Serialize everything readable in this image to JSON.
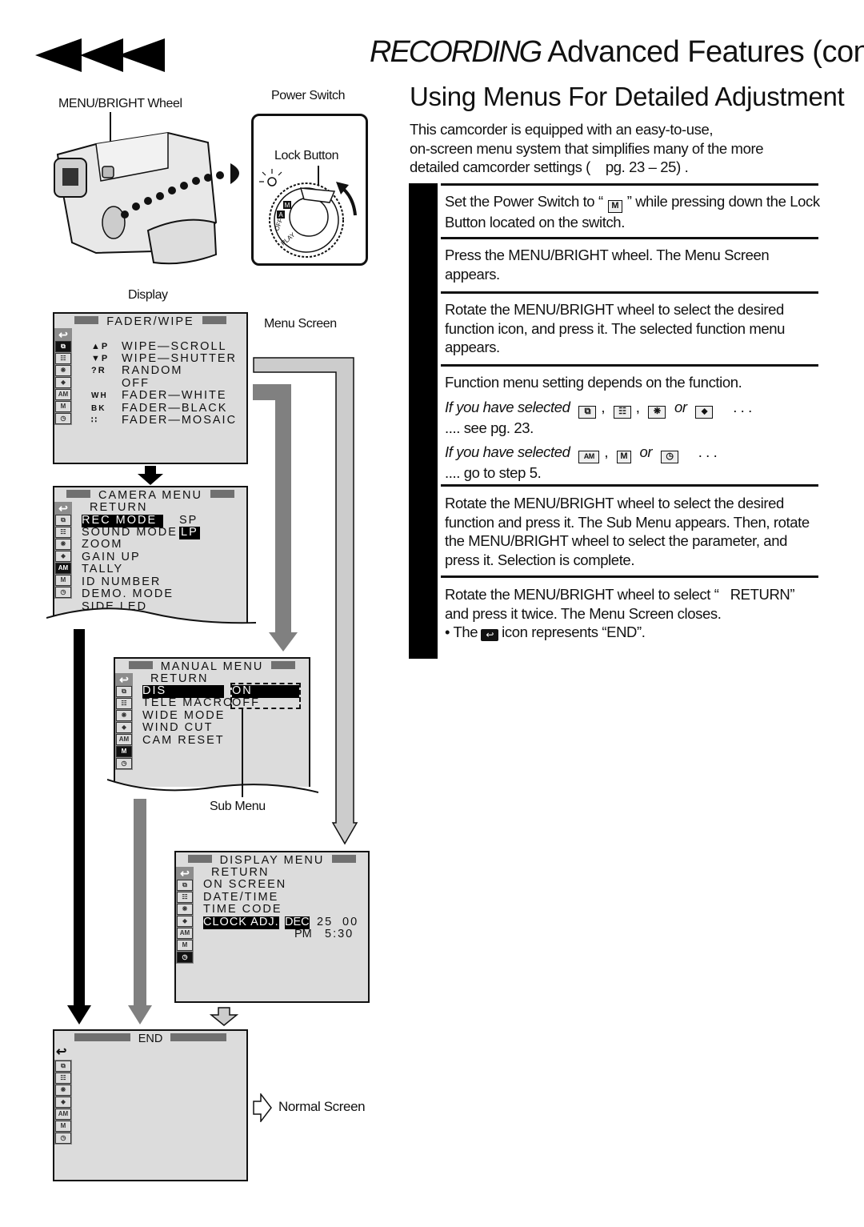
{
  "header": {
    "nav_icon": "rewind-arrows-icon",
    "title_italic": "RECORDING",
    "title_rest": "Advanced Features (cont.)"
  },
  "section": {
    "title": "Using Menus For Detailed Adjustment",
    "intro_lines": [
      "This camcorder is equipped with an easy-to-use,",
      "on-screen menu system that simplifies many of the more",
      "detailed camcorder settings (    pg. 23 – 25) ."
    ]
  },
  "steps": [
    {
      "lines": [
        "Set the Power Switch to “ [M] ” while pressing down",
        "the Lock Button located on the switch."
      ],
      "text_a": "Set the Power Switch to “",
      "icon": "M",
      "text_b": "” while pressing down the Lock Button located on the switch."
    },
    {
      "text": "Press the MENU/BRIGHT wheel. The Menu Screen appears."
    },
    {
      "text": "Rotate the MENU/BRIGHT wheel to select the desired function icon, and press it. The selected function menu appears."
    },
    {
      "text": "Function menu setting depends on the function.",
      "case1_prefix": "If you have selected",
      "case1_icons": [
        "wipe-icon",
        "scene-icon",
        "effects-icon",
        "exposure-icon"
      ],
      "case1_sep": ",",
      "case1_or": "or",
      "case1_suffix": ". . .",
      "case1_result": ".... see pg. 23.",
      "case2_prefix": "If you have selected",
      "case2_icons": [
        "camera-menu-icon",
        "manual-menu-icon",
        "display-menu-icon"
      ],
      "case2_or": "or",
      "case2_suffix": ". . .",
      "case2_result": ".... go to step 5."
    },
    {
      "text": "Rotate the MENU/BRIGHT wheel to select the desired function and press it. The Sub Menu appears. Then, rotate the MENU/BRIGHT wheel to select the parameter, and press it. Selection is complete."
    },
    {
      "text": "Rotate the MENU/BRIGHT wheel to select “   RETURN” and press it twice. The Menu Screen closes.",
      "note_prefix": "• The",
      "note_suffix": "icon represents “END”."
    }
  ],
  "labels": {
    "menu_bright_wheel": "MENU/BRIGHT Wheel",
    "power_switch": "Power Switch",
    "lock_button": "Lock Button",
    "display": "Display",
    "menu_screen": "Menu Screen",
    "sub_menu": "Sub Menu",
    "normal_screen": "Normal Screen"
  },
  "power_dial": {
    "positions": [
      "PLAY",
      "OFF",
      "A",
      "M"
    ]
  },
  "screens": {
    "fader_wipe": {
      "title": "FADER/WIPE",
      "items": [
        {
          "icon": "▲P",
          "label": "WIPE—SCROLL"
        },
        {
          "icon": "▼P",
          "label": "WIPE—SHUTTER"
        },
        {
          "icon": "?R",
          "label": "RANDOM"
        },
        {
          "icon": "",
          "label": "OFF"
        },
        {
          "icon": "WH",
          "label": "FADER—WHITE"
        },
        {
          "icon": "BK",
          "label": "FADER—BLACK"
        },
        {
          "icon": "∷",
          "label": "FADER—MOSAIC"
        }
      ]
    },
    "camera_menu": {
      "title": "CAMERA MENU",
      "items": [
        "RETURN",
        "REC MODE",
        "SOUND MODE",
        "ZOOM",
        "GAIN UP",
        "TALLY",
        "ID NUMBER",
        "DEMO. MODE",
        "SIDE LED"
      ],
      "selected": "REC MODE",
      "values": [
        "SP",
        "LP"
      ],
      "selected_value": "LP"
    },
    "manual_menu": {
      "title": "MANUAL MENU",
      "items": [
        "RETURN",
        "DIS",
        "TELE MACRO",
        "WIDE MODE",
        "WIND CUT",
        "CAM RESET"
      ],
      "selected": "DIS",
      "sub_options": [
        "ON",
        "OFF"
      ],
      "selected_option": "ON"
    },
    "display_menu": {
      "title": "DISPLAY MENU",
      "items": [
        "RETURN",
        "ON SCREEN",
        "DATE/TIME",
        "TIME CODE",
        "CLOCK ADJ."
      ],
      "selected": "CLOCK ADJ.",
      "clock_month": "DEC",
      "clock_day": "25",
      "clock_year": "00",
      "clock_ampm": "PM",
      "clock_time": "5:30"
    },
    "end": {
      "title": "END"
    }
  },
  "side_icons": [
    {
      "name": "return-icon",
      "glyph": "↩"
    },
    {
      "name": "wipe-fader-icon",
      "glyph": "⧉"
    },
    {
      "name": "program-ae-icon",
      "glyph": "☷"
    },
    {
      "name": "effects-icon",
      "glyph": "❋"
    },
    {
      "name": "exposure-icon",
      "glyph": "⬥"
    },
    {
      "name": "camera-menu-icon",
      "glyph": "AM"
    },
    {
      "name": "manual-menu-icon",
      "glyph": "M"
    },
    {
      "name": "display-menu-icon",
      "glyph": "◷"
    }
  ],
  "colors": {
    "screen_bg": "#dcdcdc",
    "sidebar_bg": "#8c8c8c",
    "title_bar": "#707070",
    "arrow_dark_gray": "#808080",
    "arrow_light_gray": "#cccccc",
    "highlight": "#000000"
  }
}
